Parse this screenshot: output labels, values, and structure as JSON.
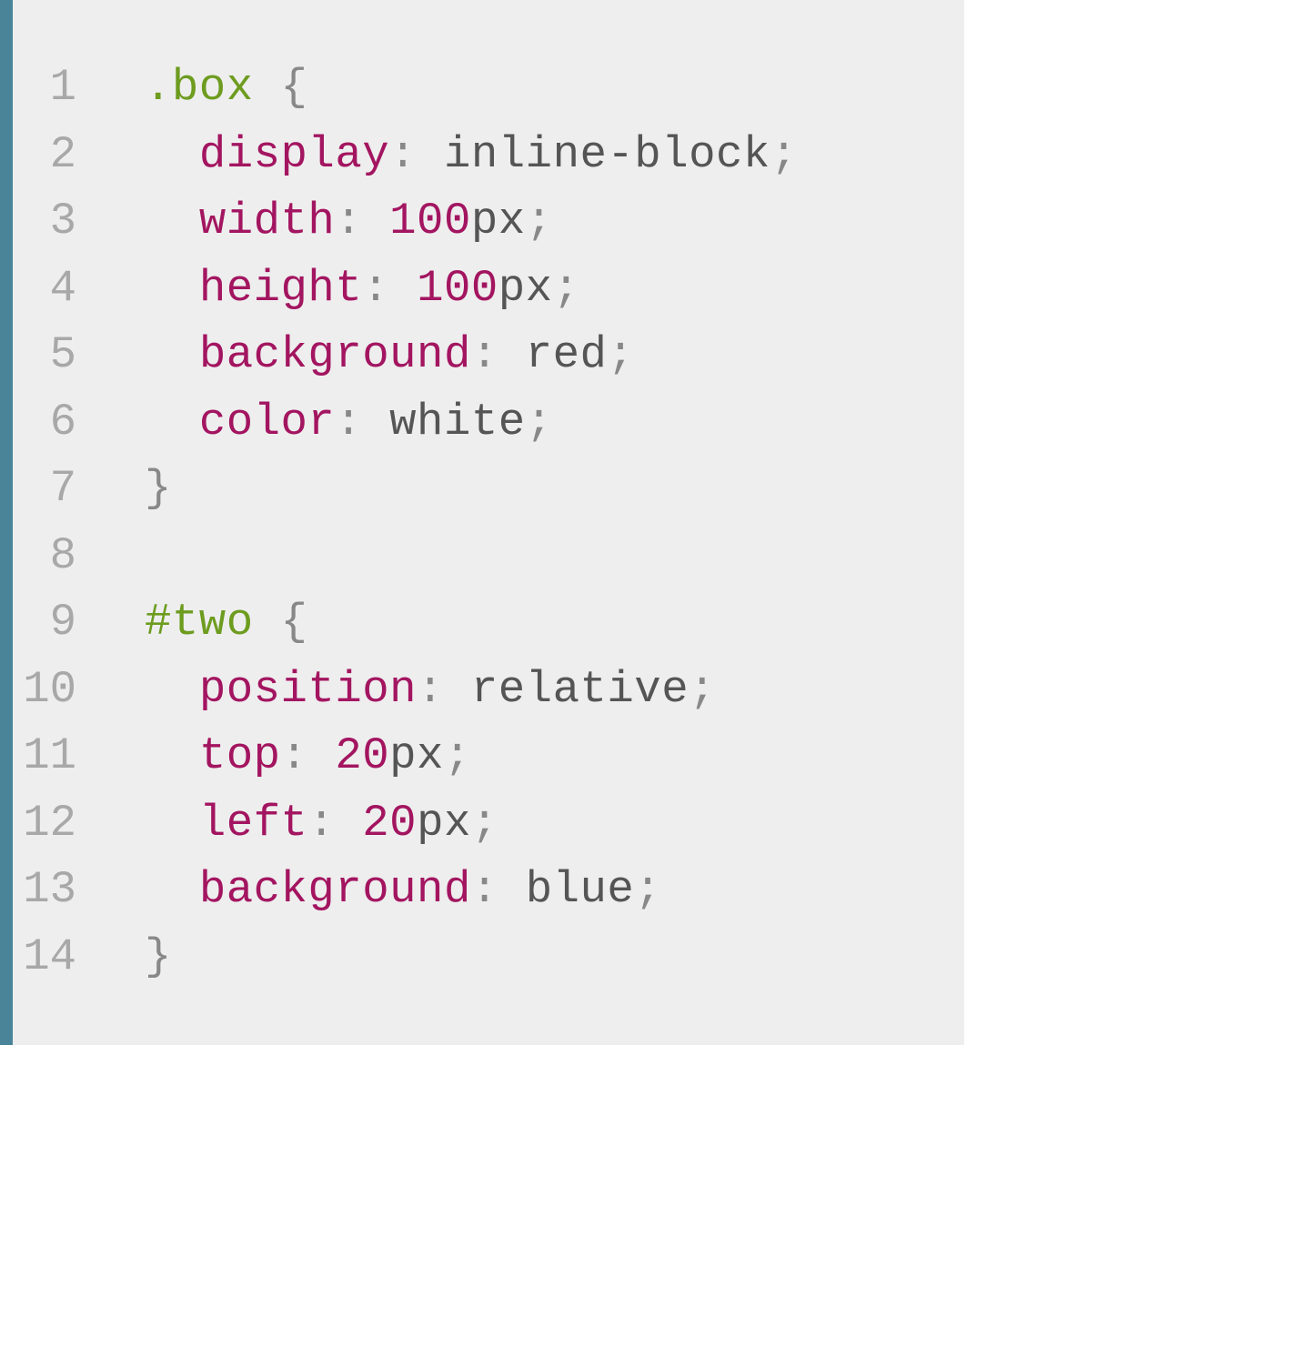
{
  "code": {
    "lines": [
      {
        "num": "1",
        "tokens": [
          {
            "t": "selector",
            "v": ".box"
          },
          {
            "t": "space",
            "v": " "
          },
          {
            "t": "brace",
            "v": "{"
          }
        ]
      },
      {
        "num": "2",
        "tokens": [
          {
            "t": "indent",
            "v": "  "
          },
          {
            "t": "property",
            "v": "display"
          },
          {
            "t": "punct",
            "v": ":"
          },
          {
            "t": "space",
            "v": " "
          },
          {
            "t": "value",
            "v": "inline-block"
          },
          {
            "t": "punct",
            "v": ";"
          }
        ]
      },
      {
        "num": "3",
        "tokens": [
          {
            "t": "indent",
            "v": "  "
          },
          {
            "t": "property",
            "v": "width"
          },
          {
            "t": "punct",
            "v": ":"
          },
          {
            "t": "space",
            "v": " "
          },
          {
            "t": "number",
            "v": "100"
          },
          {
            "t": "unit",
            "v": "px"
          },
          {
            "t": "punct",
            "v": ";"
          }
        ]
      },
      {
        "num": "4",
        "tokens": [
          {
            "t": "indent",
            "v": "  "
          },
          {
            "t": "property",
            "v": "height"
          },
          {
            "t": "punct",
            "v": ":"
          },
          {
            "t": "space",
            "v": " "
          },
          {
            "t": "number",
            "v": "100"
          },
          {
            "t": "unit",
            "v": "px"
          },
          {
            "t": "punct",
            "v": ";"
          }
        ]
      },
      {
        "num": "5",
        "tokens": [
          {
            "t": "indent",
            "v": "  "
          },
          {
            "t": "property",
            "v": "background"
          },
          {
            "t": "punct",
            "v": ":"
          },
          {
            "t": "space",
            "v": " "
          },
          {
            "t": "value",
            "v": "red"
          },
          {
            "t": "punct",
            "v": ";"
          }
        ]
      },
      {
        "num": "6",
        "tokens": [
          {
            "t": "indent",
            "v": "  "
          },
          {
            "t": "property",
            "v": "color"
          },
          {
            "t": "punct",
            "v": ":"
          },
          {
            "t": "space",
            "v": " "
          },
          {
            "t": "value",
            "v": "white"
          },
          {
            "t": "punct",
            "v": ";"
          }
        ]
      },
      {
        "num": "7",
        "tokens": [
          {
            "t": "brace",
            "v": "}"
          }
        ]
      },
      {
        "num": "8",
        "tokens": [
          {
            "t": "space",
            "v": " "
          }
        ]
      },
      {
        "num": "9",
        "tokens": [
          {
            "t": "selector",
            "v": "#two"
          },
          {
            "t": "space",
            "v": " "
          },
          {
            "t": "brace",
            "v": "{"
          }
        ]
      },
      {
        "num": "10",
        "tokens": [
          {
            "t": "indent",
            "v": "  "
          },
          {
            "t": "property",
            "v": "position"
          },
          {
            "t": "punct",
            "v": ":"
          },
          {
            "t": "space",
            "v": " "
          },
          {
            "t": "value",
            "v": "relative"
          },
          {
            "t": "punct",
            "v": ";"
          }
        ]
      },
      {
        "num": "11",
        "tokens": [
          {
            "t": "indent",
            "v": "  "
          },
          {
            "t": "property",
            "v": "top"
          },
          {
            "t": "punct",
            "v": ":"
          },
          {
            "t": "space",
            "v": " "
          },
          {
            "t": "number",
            "v": "20"
          },
          {
            "t": "unit",
            "v": "px"
          },
          {
            "t": "punct",
            "v": ";"
          }
        ]
      },
      {
        "num": "12",
        "tokens": [
          {
            "t": "indent",
            "v": "  "
          },
          {
            "t": "property",
            "v": "left"
          },
          {
            "t": "punct",
            "v": ":"
          },
          {
            "t": "space",
            "v": " "
          },
          {
            "t": "number",
            "v": "20"
          },
          {
            "t": "unit",
            "v": "px"
          },
          {
            "t": "punct",
            "v": ";"
          }
        ]
      },
      {
        "num": "13",
        "tokens": [
          {
            "t": "indent",
            "v": "  "
          },
          {
            "t": "property",
            "v": "background"
          },
          {
            "t": "punct",
            "v": ":"
          },
          {
            "t": "space",
            "v": " "
          },
          {
            "t": "value",
            "v": "blue"
          },
          {
            "t": "punct",
            "v": ";"
          }
        ]
      },
      {
        "num": "14",
        "tokens": [
          {
            "t": "brace",
            "v": "}"
          }
        ]
      }
    ]
  }
}
